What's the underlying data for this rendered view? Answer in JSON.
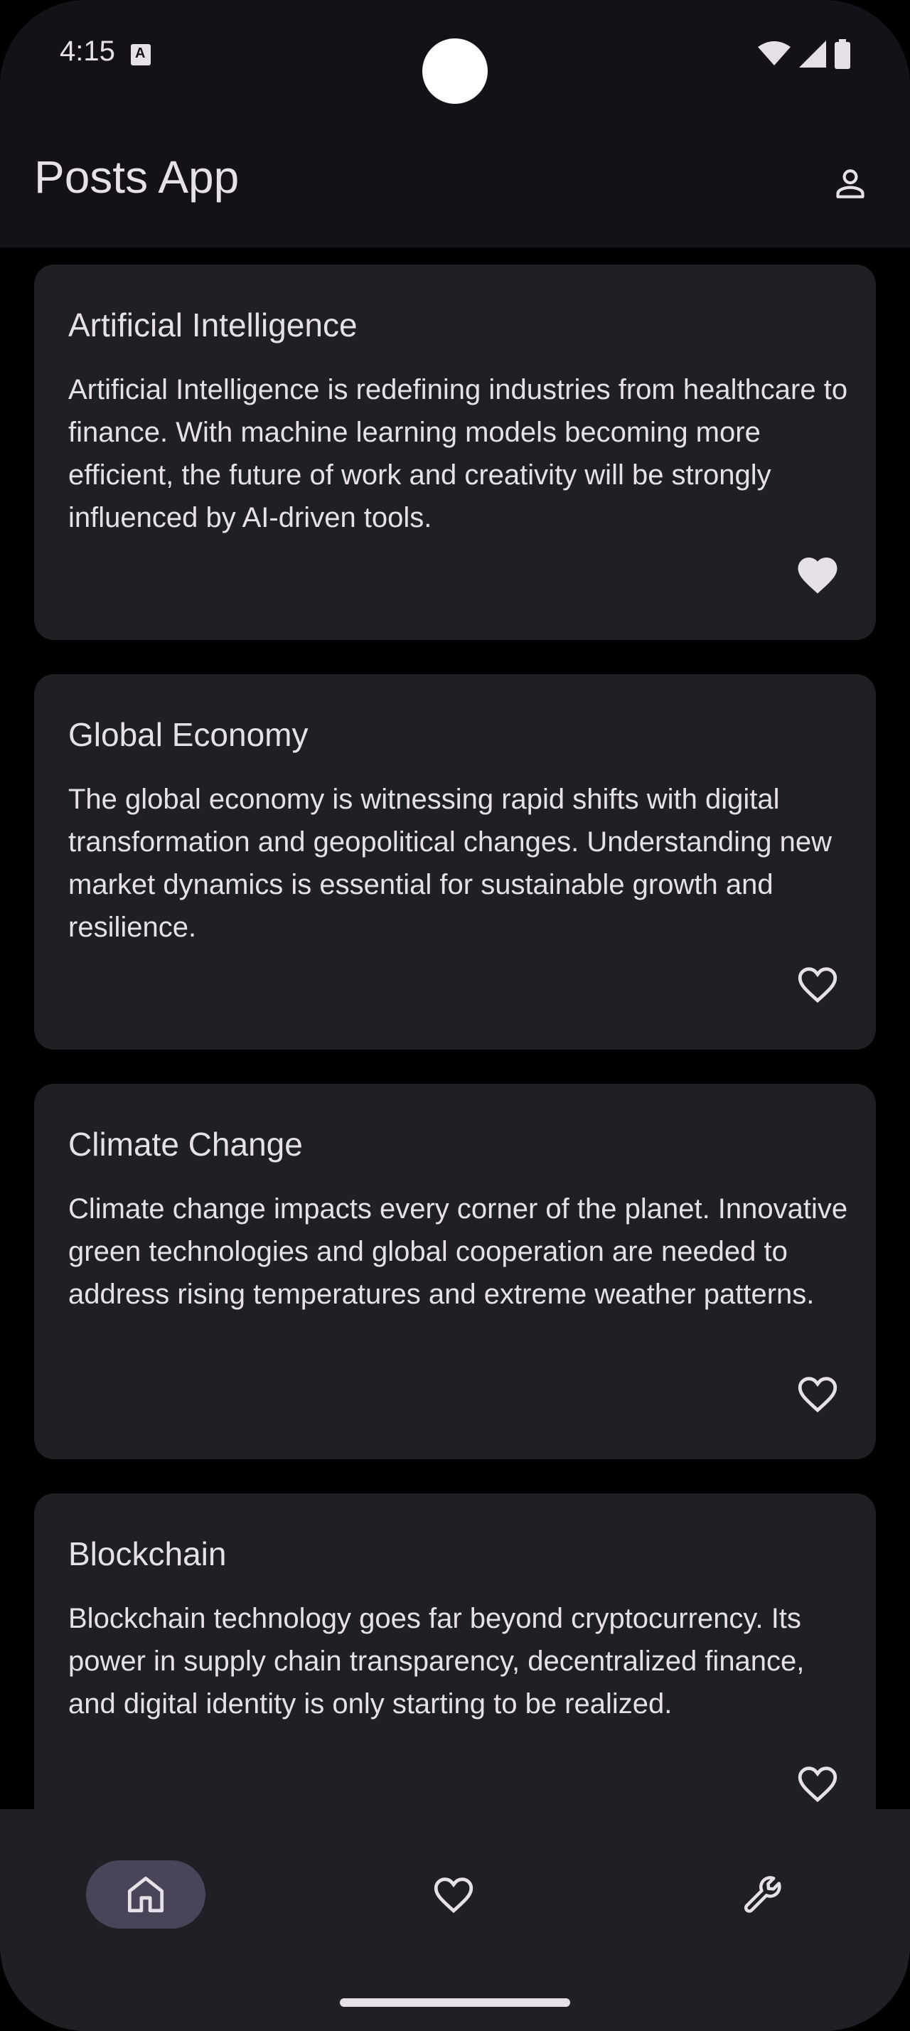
{
  "status_bar": {
    "time": "4:15"
  },
  "app_bar": {
    "title": "Posts App",
    "account_icon": "person-outline-icon"
  },
  "posts": [
    {
      "title": "Artificial Intelligence",
      "body": "Artificial Intelligence is redefining industries from healthcare to finance. With machine learning models becoming more efficient, the future of work and creativity will be strongly influenced by AI-driven tools.",
      "favorited": true
    },
    {
      "title": "Global Economy",
      "body": "The global economy is witnessing rapid shifts with digital transformation and geopolitical changes. Understanding new market dynamics is essential for sustainable growth and resilience.",
      "favorited": false
    },
    {
      "title": "Climate Change",
      "body": "Climate change impacts every corner of the planet. Innovative green technologies and global cooperation are needed to address rising temperatures and extreme weather patterns.",
      "favorited": false
    },
    {
      "title": "Blockchain",
      "body": "Blockchain technology goes far beyond cryptocurrency. Its power in supply chain transparency, decentralized finance, and digital identity is only starting to be realized.",
      "favorited": false
    }
  ],
  "bottom_nav": {
    "items": [
      {
        "icon": "home-icon",
        "selected": true
      },
      {
        "icon": "heart-outline-icon",
        "selected": false
      },
      {
        "icon": "wrench-icon",
        "selected": false
      }
    ]
  },
  "colors": {
    "background": "#000000",
    "surface": "#141218",
    "card": "#211f26",
    "text": "#e6e1e6",
    "nav_indicator": "#4a4458"
  }
}
